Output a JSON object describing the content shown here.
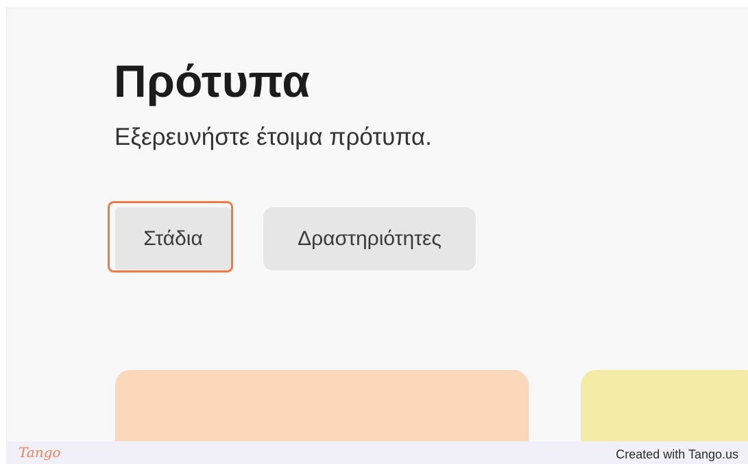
{
  "header": {
    "title": "Πρότυπα",
    "subtitle": "Εξερευνήστε έτοιμα πρότυπα."
  },
  "tabs": [
    {
      "label": "Στάδια",
      "highlighted": true
    },
    {
      "label": "Δραστηριότητες",
      "highlighted": false
    }
  ],
  "cards": [
    {
      "color": "#fbd7bc",
      "icon": "template-icon"
    },
    {
      "color": "#f4eca6"
    }
  ],
  "footer": {
    "logo": "Tango",
    "credit": "Created with Tango.us"
  },
  "colors": {
    "highlight": "#f07a46",
    "page_background": "#f8f8f9",
    "tab_background": "#e6e6e6",
    "footer_background": "#f1eff7"
  }
}
